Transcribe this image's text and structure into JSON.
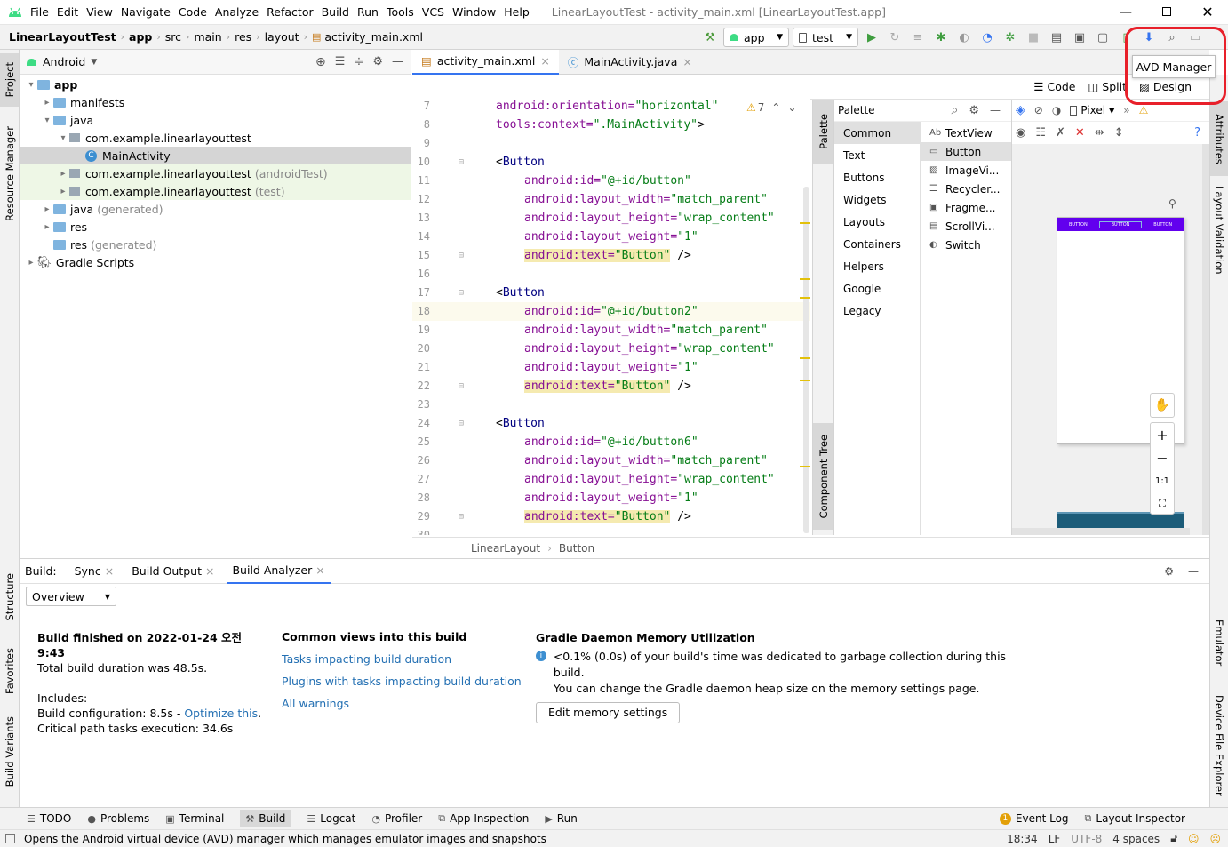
{
  "app": {
    "window_title": "LinearLayoutTest - activity_main.xml [LinearLayoutTest.app]",
    "menu": [
      "File",
      "Edit",
      "View",
      "Navigate",
      "Code",
      "Analyze",
      "Refactor",
      "Build",
      "Run",
      "Tools",
      "VCS",
      "Window",
      "Help"
    ]
  },
  "breadcrumb": [
    "LinearLayoutTest",
    "app",
    "src",
    "main",
    "res",
    "layout",
    "activity_main.xml"
  ],
  "toolbar": {
    "run_config": "app",
    "device": "test",
    "tooltip": "AVD Manager"
  },
  "project_panel": {
    "view_mode": "Android",
    "tree": [
      {
        "label": "app",
        "level": 0,
        "arrow": "▾",
        "icon": "folder",
        "bold": true
      },
      {
        "label": "manifests",
        "level": 1,
        "arrow": "▸",
        "icon": "folder"
      },
      {
        "label": "java",
        "level": 1,
        "arrow": "▾",
        "icon": "folder"
      },
      {
        "label": "com.example.linearlayouttest",
        "level": 2,
        "arrow": "▾",
        "icon": "package"
      },
      {
        "label": "MainActivity",
        "level": 3,
        "arrow": "",
        "icon": "class",
        "selected": true
      },
      {
        "label": "com.example.linearlayouttest",
        "suffix": "(androidTest)",
        "level": 2,
        "arrow": "▸",
        "icon": "package",
        "green": true
      },
      {
        "label": "com.example.linearlayouttest",
        "suffix": "(test)",
        "level": 2,
        "arrow": "▸",
        "icon": "package",
        "green": true
      },
      {
        "label": "java",
        "suffix": "(generated)",
        "level": 1,
        "arrow": "▸",
        "icon": "folder"
      },
      {
        "label": "res",
        "level": 1,
        "arrow": "▸",
        "icon": "folder"
      },
      {
        "label": "res",
        "suffix": "(generated)",
        "level": 1,
        "arrow": "",
        "icon": "folder"
      },
      {
        "label": "Gradle Scripts",
        "level": 0,
        "arrow": "▸",
        "icon": "gradle"
      }
    ]
  },
  "left_strip": [
    "Project",
    "Resource Manager"
  ],
  "left_strip_bottom": [
    "Structure",
    "Favorites",
    "Build Variants"
  ],
  "right_strip": [
    "Attributes",
    "Layout Validation"
  ],
  "right_strip_bottom": [
    "Emulator",
    "Device File Explorer"
  ],
  "editor": {
    "tabs": [
      {
        "label": "activity_main.xml",
        "active": true,
        "close": "×"
      },
      {
        "label": "MainActivity.java",
        "active": false,
        "close": "×"
      }
    ],
    "view_modes": [
      "Code",
      "Split",
      "Design"
    ],
    "warning_count": "7",
    "lines": [
      {
        "n": "7",
        "indent": 0,
        "parts": [
          [
            "attr",
            "android:orientation="
          ],
          [
            "val",
            "\"horizontal\""
          ]
        ]
      },
      {
        "n": "8",
        "indent": 0,
        "parts": [
          [
            "attr",
            "tools:context="
          ],
          [
            "val",
            "\".MainActivity\""
          ],
          [
            "plain",
            ">"
          ]
        ]
      },
      {
        "n": "9",
        "indent": 0,
        "parts": []
      },
      {
        "n": "10",
        "indent": 0,
        "parts": [
          [
            "plain",
            "<"
          ],
          [
            "tag",
            "Button"
          ]
        ]
      },
      {
        "n": "11",
        "indent": 1,
        "parts": [
          [
            "attr",
            "android:id="
          ],
          [
            "val",
            "\"@+id/button\""
          ]
        ]
      },
      {
        "n": "12",
        "indent": 1,
        "parts": [
          [
            "attr",
            "android:layout_width="
          ],
          [
            "val",
            "\"match_parent\""
          ]
        ]
      },
      {
        "n": "13",
        "indent": 1,
        "parts": [
          [
            "attr",
            "android:layout_height="
          ],
          [
            "val",
            "\"wrap_content\""
          ]
        ]
      },
      {
        "n": "14",
        "indent": 1,
        "parts": [
          [
            "attr",
            "android:layout_weight="
          ],
          [
            "val",
            "\"1\""
          ]
        ]
      },
      {
        "n": "15",
        "indent": 1,
        "parts": [
          [
            "hlattr",
            "android:text="
          ],
          [
            "hlval",
            "\"Button\""
          ],
          [
            "plain",
            " />"
          ]
        ]
      },
      {
        "n": "16",
        "indent": 0,
        "parts": []
      },
      {
        "n": "17",
        "indent": 0,
        "parts": [
          [
            "plain",
            "<"
          ],
          [
            "tag",
            "Button"
          ]
        ]
      },
      {
        "n": "18",
        "indent": 1,
        "parts": [
          [
            "attr",
            "android:id="
          ],
          [
            "val",
            "\"@+id/button2\""
          ]
        ],
        "current": true
      },
      {
        "n": "19",
        "indent": 1,
        "parts": [
          [
            "attr",
            "android:layout_width="
          ],
          [
            "val",
            "\"match_parent\""
          ]
        ]
      },
      {
        "n": "20",
        "indent": 1,
        "parts": [
          [
            "attr",
            "android:layout_height="
          ],
          [
            "val",
            "\"wrap_content\""
          ]
        ]
      },
      {
        "n": "21",
        "indent": 1,
        "parts": [
          [
            "attr",
            "android:layout_weight="
          ],
          [
            "val",
            "\"1\""
          ]
        ]
      },
      {
        "n": "22",
        "indent": 1,
        "parts": [
          [
            "hlattr",
            "android:text="
          ],
          [
            "hlval",
            "\"Button\""
          ],
          [
            "plain",
            " />"
          ]
        ]
      },
      {
        "n": "23",
        "indent": 0,
        "parts": []
      },
      {
        "n": "24",
        "indent": 0,
        "parts": [
          [
            "plain",
            "<"
          ],
          [
            "tag",
            "Button"
          ]
        ]
      },
      {
        "n": "25",
        "indent": 1,
        "parts": [
          [
            "attr",
            "android:id="
          ],
          [
            "val",
            "\"@+id/button6\""
          ]
        ]
      },
      {
        "n": "26",
        "indent": 1,
        "parts": [
          [
            "attr",
            "android:layout_width="
          ],
          [
            "val",
            "\"match_parent\""
          ]
        ]
      },
      {
        "n": "27",
        "indent": 1,
        "parts": [
          [
            "attr",
            "android:layout_height="
          ],
          [
            "val",
            "\"wrap_content\""
          ]
        ]
      },
      {
        "n": "28",
        "indent": 1,
        "parts": [
          [
            "attr",
            "android:layout_weight="
          ],
          [
            "val",
            "\"1\""
          ]
        ]
      },
      {
        "n": "29",
        "indent": 1,
        "parts": [
          [
            "hlattr",
            "android:text="
          ],
          [
            "hlval",
            "\"Button\""
          ],
          [
            "plain",
            " />"
          ]
        ]
      },
      {
        "n": "30",
        "indent": 0,
        "parts": []
      }
    ],
    "breadcrumb": [
      "LinearLayout",
      "Button"
    ]
  },
  "palette": {
    "title": "Palette",
    "side_label": "Palette",
    "tree_label": "Component Tree",
    "categories": [
      "Common",
      "Text",
      "Buttons",
      "Widgets",
      "Layouts",
      "Containers",
      "Helpers",
      "Google",
      "Legacy"
    ],
    "items": [
      {
        "label": "TextView",
        "icon": "Ab"
      },
      {
        "label": "Button",
        "icon": "▭",
        "selected": true
      },
      {
        "label": "ImageVi...",
        "icon": "▨"
      },
      {
        "label": "Recycler...",
        "icon": "☰"
      },
      {
        "label": "Fragme...",
        "icon": "▣"
      },
      {
        "label": "ScrollVi...",
        "icon": "▤"
      },
      {
        "label": "Switch",
        "icon": "◐"
      }
    ]
  },
  "design": {
    "device": "Pixel",
    "zoom_ratio": "1:1",
    "preview_buttons": [
      "BUTTON",
      "BUTTON",
      "BUTTON"
    ]
  },
  "build": {
    "header_label": "Build:",
    "tabs": [
      {
        "label": "Sync",
        "close": "×"
      },
      {
        "label": "Build Output",
        "close": "×"
      },
      {
        "label": "Build Analyzer",
        "close": "×",
        "active": true
      }
    ],
    "dropdown": "Overview",
    "summary": {
      "title": "Build finished on 2022-01-24 오전 9:43",
      "duration": "Total build duration was 48.5s.",
      "includes": "Includes:",
      "config_prefix": "Build configuration: 8.5s - ",
      "config_link": "Optimize this",
      "config_suffix": ".",
      "critical": "Critical path tasks execution: 34.6s"
    },
    "common": {
      "title": "Common views into this build",
      "links": [
        "Tasks impacting build duration",
        "Plugins with tasks impacting build duration",
        "All warnings"
      ]
    },
    "memory": {
      "title": "Gradle Daemon Memory Utilization",
      "line1": "<0.1% (0.0s) of your build's time was dedicated to garbage collection during this build.",
      "line2": "You can change the Gradle daemon heap size on the memory settings page.",
      "button": "Edit memory settings"
    }
  },
  "statusbar": {
    "left": [
      "TODO",
      "Problems",
      "Terminal",
      "Build",
      "Logcat",
      "Profiler",
      "App Inspection",
      "Run"
    ],
    "event_count": "1",
    "right": [
      "Event Log",
      "Layout Inspector"
    ]
  },
  "message": {
    "text": "Opens the Android virtual device (AVD) manager which manages emulator images and snapshots",
    "position": "18:34",
    "line_sep": "LF",
    "encoding": "UTF-8",
    "indent": "4 spaces"
  },
  "colors": {
    "accent": "#3574f0",
    "highlight_circle": "#e8202a",
    "preview_button": "#6200ee",
    "android_green": "#3ddc84"
  }
}
